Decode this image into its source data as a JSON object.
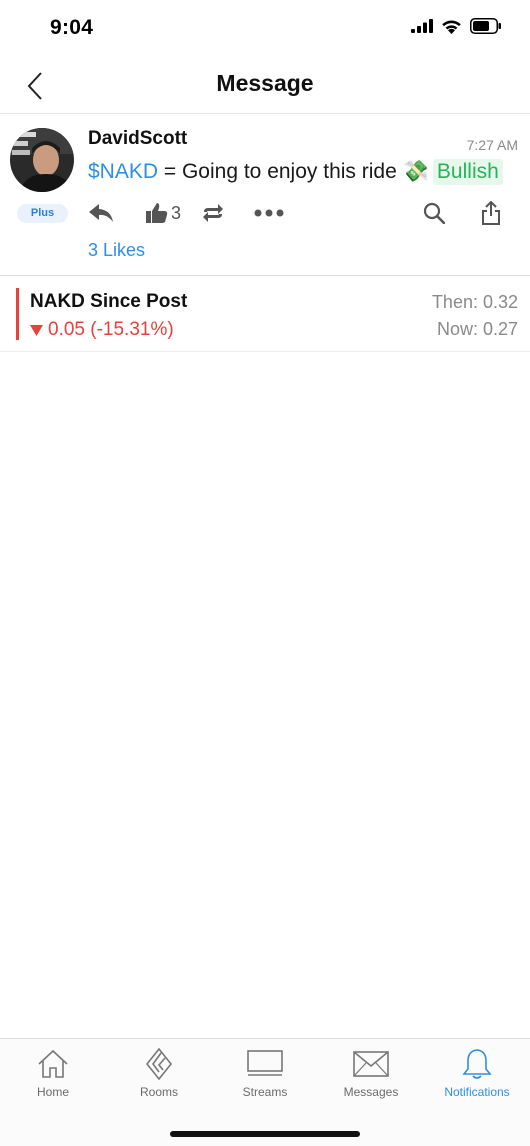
{
  "status_bar": {
    "time": "9:04"
  },
  "header": {
    "title": "Message"
  },
  "message": {
    "author": "DavidScott",
    "plan_badge": "Plus",
    "timestamp": "7:27 AM",
    "ticker": "$NAKD",
    "text": "= Going to enjoy this ride",
    "emoji": "💸",
    "sentiment": "Bullish",
    "like_count": "3",
    "likes_summary": "3 Likes"
  },
  "price_card": {
    "title": "NAKD Since Post",
    "change": "0.05 (-15.31%)",
    "then": "Then: 0.32",
    "now": "Now: 0.27"
  },
  "tab_bar": {
    "tabs": [
      {
        "label": "Home",
        "icon": "home-icon"
      },
      {
        "label": "Rooms",
        "icon": "rooms-icon"
      },
      {
        "label": "Streams",
        "icon": "streams-icon"
      },
      {
        "label": "Messages",
        "icon": "messages-icon"
      },
      {
        "label": "Notifications",
        "icon": "bell-icon",
        "active": true
      }
    ]
  },
  "colors": {
    "accent_blue": "#2d8fe3",
    "bullish_green": "#27b35a",
    "bearish_red": "#e8403a"
  }
}
